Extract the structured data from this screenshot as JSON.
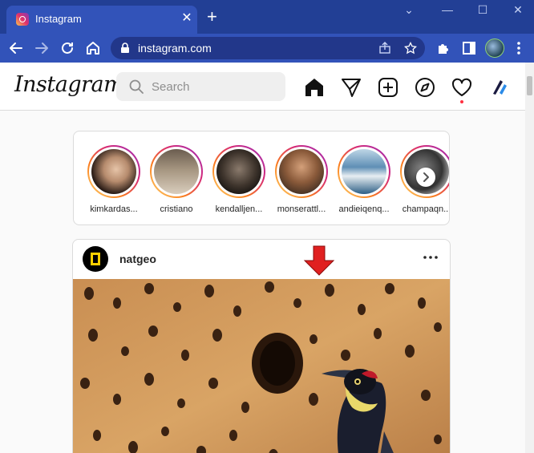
{
  "browser": {
    "tab_title": "Instagram",
    "url": "instagram.com"
  },
  "colors": {
    "browser_frame": "#223f95",
    "toolbar": "#3253b9",
    "instagram_gradient": [
      "#feda75",
      "#fa7e1e",
      "#d62976",
      "#962fbf"
    ],
    "arrow": "#e02020"
  },
  "header": {
    "logo": "Instagram",
    "search_placeholder": "Search",
    "nav_icons": [
      "home-icon",
      "direct-message-icon",
      "new-post-icon",
      "explore-icon",
      "activity-heart-icon",
      "profile-icon"
    ]
  },
  "stories": [
    {
      "username": "kimkardas..."
    },
    {
      "username": "cristiano"
    },
    {
      "username": "kendalljen..."
    },
    {
      "username": "monserattl..."
    },
    {
      "username": "andieiqenq..."
    },
    {
      "username": "champaqn..."
    }
  ],
  "post": {
    "username": "natgeo",
    "image_subject": "woodpecker-on-granary-tree"
  }
}
